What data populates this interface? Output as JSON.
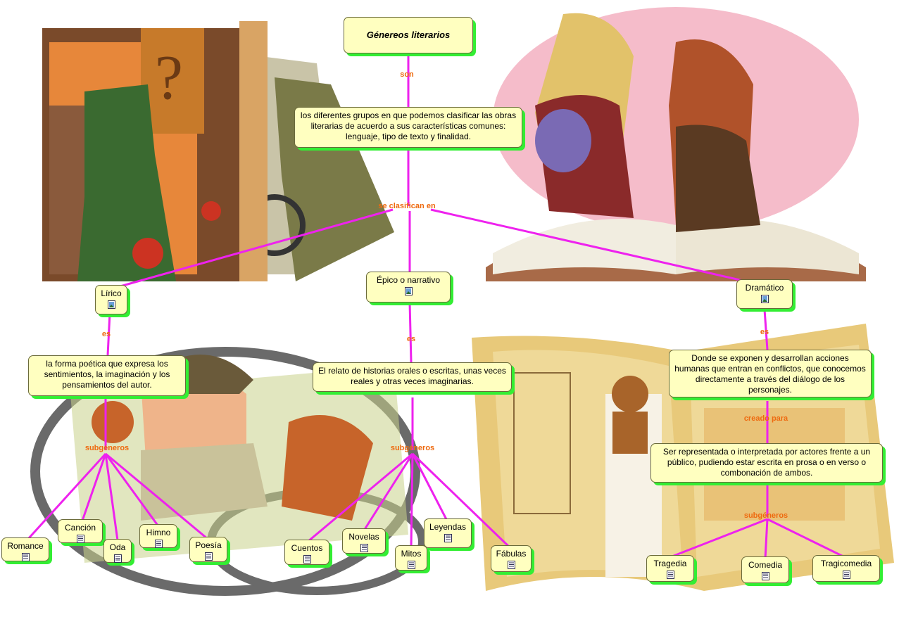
{
  "title": "Génereos literarios",
  "definition": "los diferentes grupos en que  podemos clasificar las obras literarias de acuerdo a sus características comunes: lenguaje, tipo de texto y finalidad.",
  "links": {
    "son": "son",
    "se_clasifican_en": "se clasifican en",
    "es_lirico": "es",
    "es_epico": "es",
    "es_dramatico": "es",
    "subgeneros_lirico": "subgéneros",
    "subgeneros_epico": "subgéneros",
    "creado_para": "creado para",
    "subgeneros_dramatico": "subgéneros"
  },
  "genres": {
    "lirico": {
      "label": "Lírico",
      "description": "la forma poética que expresa los sentimientos, la imaginación y los pensamientos del autor.",
      "subgenres": [
        "Romance",
        "Canción",
        "Oda",
        "Himno",
        "Poesía"
      ]
    },
    "epico": {
      "label": "Épico o narrativo",
      "description": "El relato de historias orales o escritas, unas veces reales y otras veces imaginarias.",
      "subgenres": [
        "Cuentos",
        "Novelas",
        "Mitos",
        "Leyendas",
        "Fábulas"
      ]
    },
    "dramatico": {
      "label": "Dramático",
      "description": "Donde se exponen y desarrollan acciones humanas que entran en conflictos, que conocemos directamente a través del diálogo de los personajes.",
      "purpose": "Ser representada o interpretada por actores frente a un público, pudiendo estar escrita en prosa o en verso o combonación de ambos.",
      "subgenres": [
        "Tragedia",
        "Comedia",
        "Tragicomedia"
      ]
    }
  },
  "colors": {
    "link_line": "#ee22ee",
    "link_label": "#ee6a10",
    "node_fill": "#ffffc0",
    "node_shadow": "#33ee33"
  },
  "icons": {
    "image_resource": "image-icon",
    "document_resource": "document-icon"
  }
}
